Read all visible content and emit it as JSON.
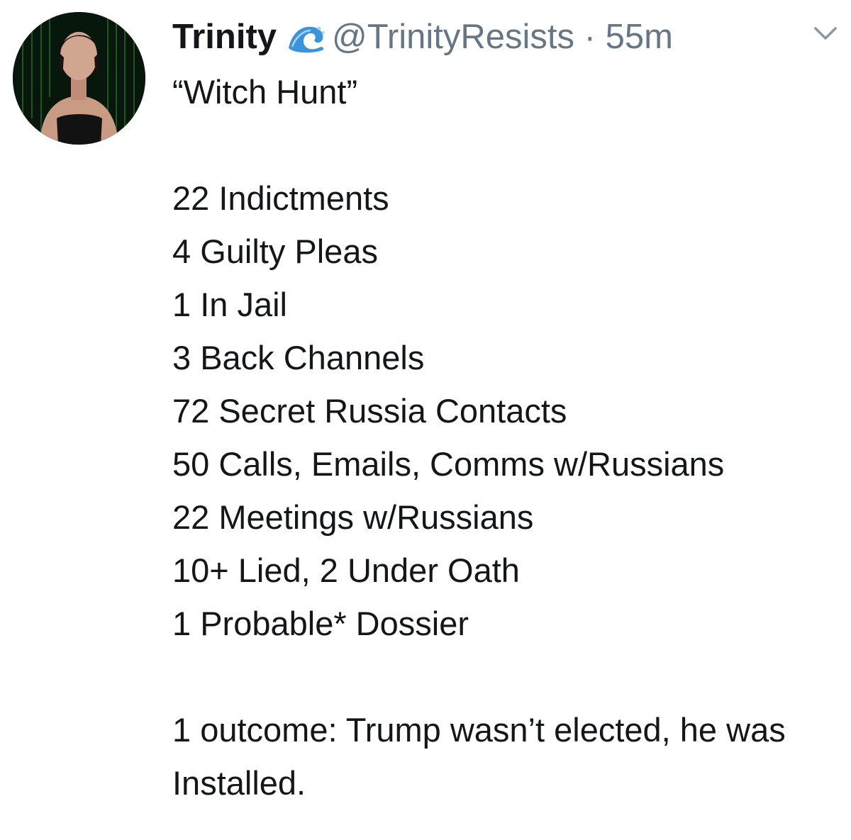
{
  "tweet": {
    "author": {
      "display_name": "Trinity",
      "handle": "@TrinityResists",
      "name_emoji": "water-wave-emoji"
    },
    "separator": "·",
    "timestamp": "55m",
    "menu_icon": "chevron-down-icon",
    "lines": {
      "title": "“Witch Hunt”",
      "l1": "22 Indictments",
      "l2": "4 Guilty Pleas",
      "l3": "1 In Jail",
      "l4": "3 Back Channels",
      "l5": "72 Secret Russia Contacts",
      "l6": "50 Calls, Emails, Comms w/Russians",
      "l7": "22 Meetings w/Russians",
      "l8": "10+ Lied, 2 Under Oath",
      "l9": "1 Probable* Dossier",
      "outcome": "1 outcome: Trump wasn’t elected, he was Installed."
    },
    "colors": {
      "text": "#14171a",
      "secondary": "#657786",
      "wave": "#3b94d9"
    }
  }
}
